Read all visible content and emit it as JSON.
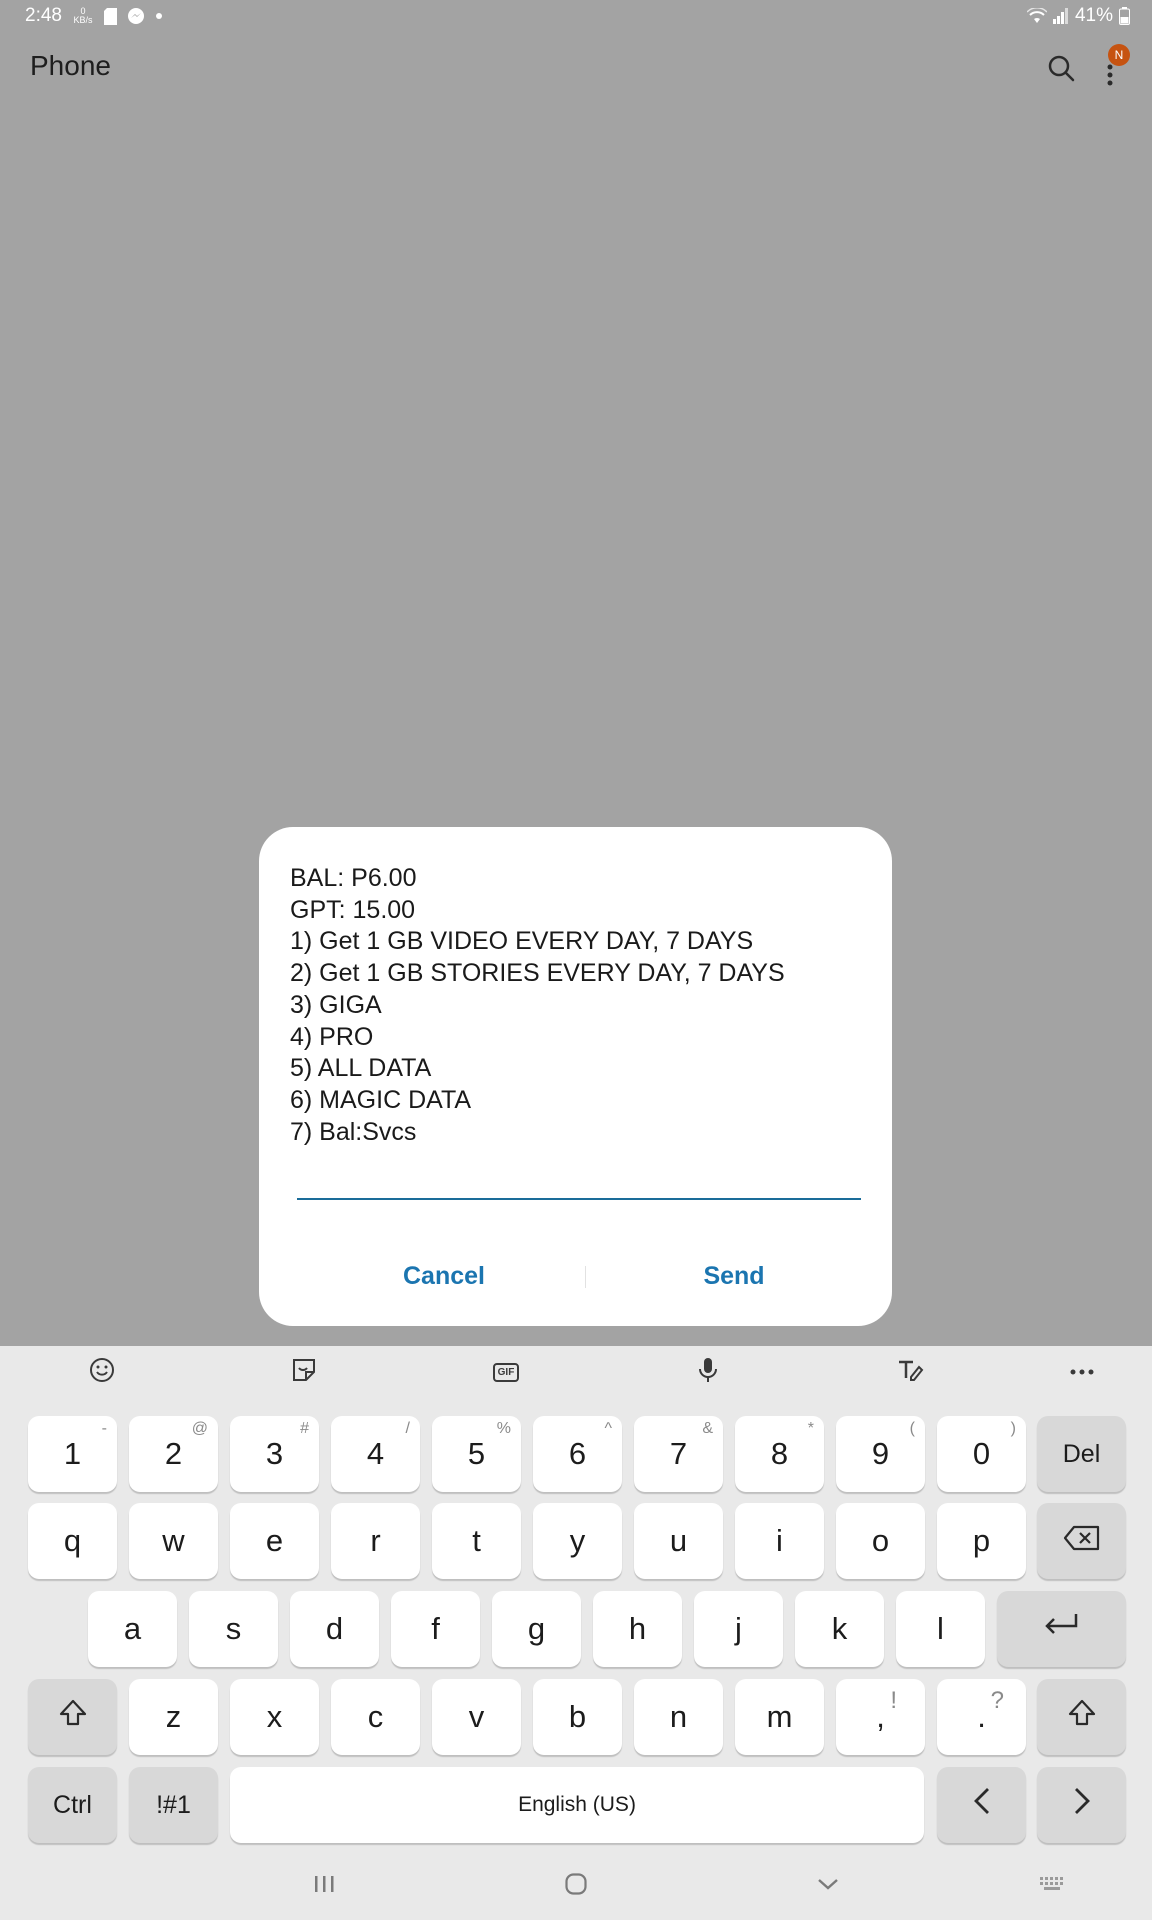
{
  "status_bar": {
    "time": "2:48",
    "net_speed_value": "0",
    "net_speed_unit": "KB/s",
    "battery": "41%"
  },
  "app_bar": {
    "title": "Phone",
    "notification_badge": "N"
  },
  "dialog": {
    "lines": [
      "BAL: P6.00",
      "GPT: 15.00",
      "1) Get 1 GB VIDEO EVERY DAY, 7 DAYS",
      "2) Get 1 GB STORIES EVERY DAY, 7 DAYS",
      "3) GIGA",
      "4) PRO",
      "5) ALL DATA",
      "6) MAGIC DATA",
      "7) Bal:Svcs"
    ],
    "input_value": "",
    "cancel_label": "Cancel",
    "send_label": "Send"
  },
  "keyboard": {
    "toolbar_icons": [
      "emoji-icon",
      "sticker-icon",
      "gif-icon",
      "microphone-icon",
      "handwriting-icon",
      "more-horizontal-icon"
    ],
    "gif_label": "GIF",
    "row1": [
      {
        "key": "1",
        "sym": "-"
      },
      {
        "key": "2",
        "sym": "@"
      },
      {
        "key": "3",
        "sym": "#"
      },
      {
        "key": "4",
        "sym": "/"
      },
      {
        "key": "5",
        "sym": "%"
      },
      {
        "key": "6",
        "sym": "^"
      },
      {
        "key": "7",
        "sym": "&"
      },
      {
        "key": "8",
        "sym": "*"
      },
      {
        "key": "9",
        "sym": "("
      },
      {
        "key": "0",
        "sym": ")"
      }
    ],
    "del_label": "Del",
    "row2": [
      "q",
      "w",
      "e",
      "r",
      "t",
      "y",
      "u",
      "i",
      "o",
      "p"
    ],
    "row3": [
      "a",
      "s",
      "d",
      "f",
      "g",
      "h",
      "j",
      "k",
      "l"
    ],
    "row4": [
      "z",
      "x",
      "c",
      "v",
      "b",
      "n",
      "m"
    ],
    "comma": {
      "key": ",",
      "sym": "!"
    },
    "period": {
      "key": ".",
      "sym": "?"
    },
    "ctrl_label": "Ctrl",
    "symbols_label": "!#1",
    "space_label": "English (US)"
  },
  "nav_bar": {
    "icons": [
      "recents-icon",
      "home-icon",
      "back-chevron-icon",
      "keyboard-icon"
    ]
  },
  "colors": {
    "background": "#a3a3a3",
    "accent": "#1b75b0",
    "badge": "#c65311",
    "keyboard_bg": "#e9e9e9"
  }
}
